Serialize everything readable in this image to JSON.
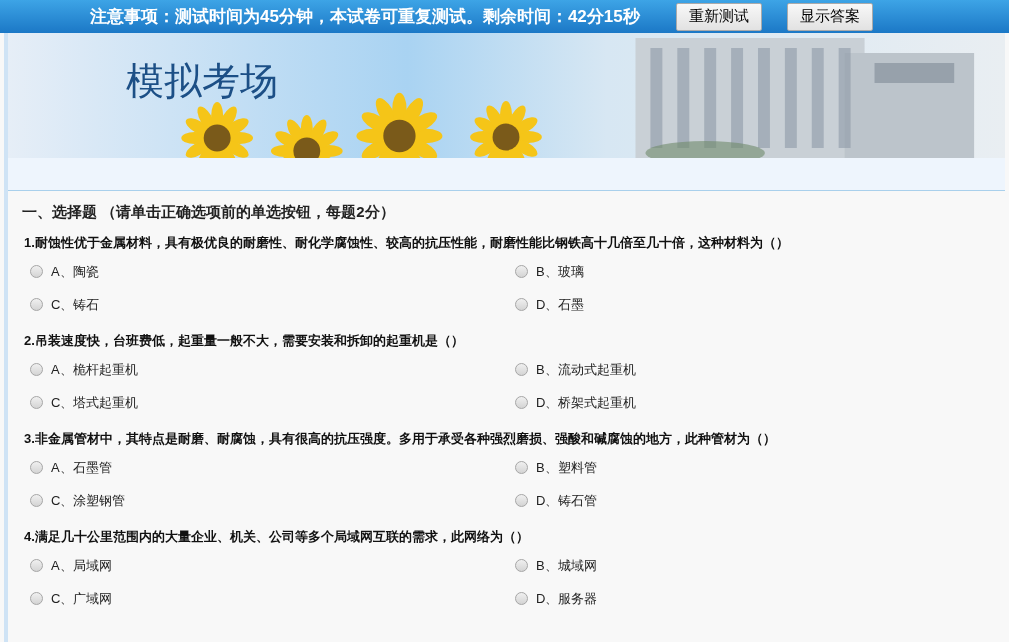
{
  "top_bar": {
    "notice": "注意事项：测试时间为45分钟，本试卷可重复测试。剩余时间：42分15秒",
    "buttons": [
      "重新测试",
      "显示答案"
    ]
  },
  "banner": {
    "title": "模拟考场"
  },
  "section": {
    "title": "一、选择题 （请单击正确选项前的单选按钮，每题2分）"
  },
  "questions": [
    {
      "text": "1.耐蚀性优于金属材料，具有极优良的耐磨性、耐化学腐蚀性、较高的抗压性能，耐磨性能比钢铁高十几倍至几十倍，这种材料为（）",
      "options": [
        {
          "label": "A、陶瓷",
          "selected": false
        },
        {
          "label": "B、玻璃",
          "selected": false
        },
        {
          "label": "C、铸石",
          "selected": false
        },
        {
          "label": "D、石墨",
          "selected": false
        }
      ]
    },
    {
      "text": "2.吊装速度快，台班费低，起重量一般不大，需要安装和拆卸的起重机是（）",
      "options": [
        {
          "label": "A、桅杆起重机",
          "selected": false
        },
        {
          "label": "B、流动式起重机",
          "selected": false
        },
        {
          "label": "C、塔式起重机",
          "selected": false
        },
        {
          "label": "D、桥架式起重机",
          "selected": false
        }
      ]
    },
    {
      "text": "3.非金属管材中，其特点是耐磨、耐腐蚀，具有很高的抗压强度。多用于承受各种强烈磨损、强酸和碱腐蚀的地方，此种管材为（）",
      "options": [
        {
          "label": "A、石墨管",
          "selected": false
        },
        {
          "label": "B、塑料管",
          "selected": false
        },
        {
          "label": "C、涂塑钢管",
          "selected": false
        },
        {
          "label": "D、铸石管",
          "selected": false
        }
      ]
    },
    {
      "text": "4.满足几十公里范围内的大量企业、机关、公司等多个局域网互联的需求，此网络为（）",
      "options": [
        {
          "label": "A、局域网",
          "selected": false
        },
        {
          "label": "B、城域网",
          "selected": false
        },
        {
          "label": "C、广域网",
          "selected": false
        },
        {
          "label": "D、服务器",
          "selected": false
        }
      ]
    }
  ]
}
